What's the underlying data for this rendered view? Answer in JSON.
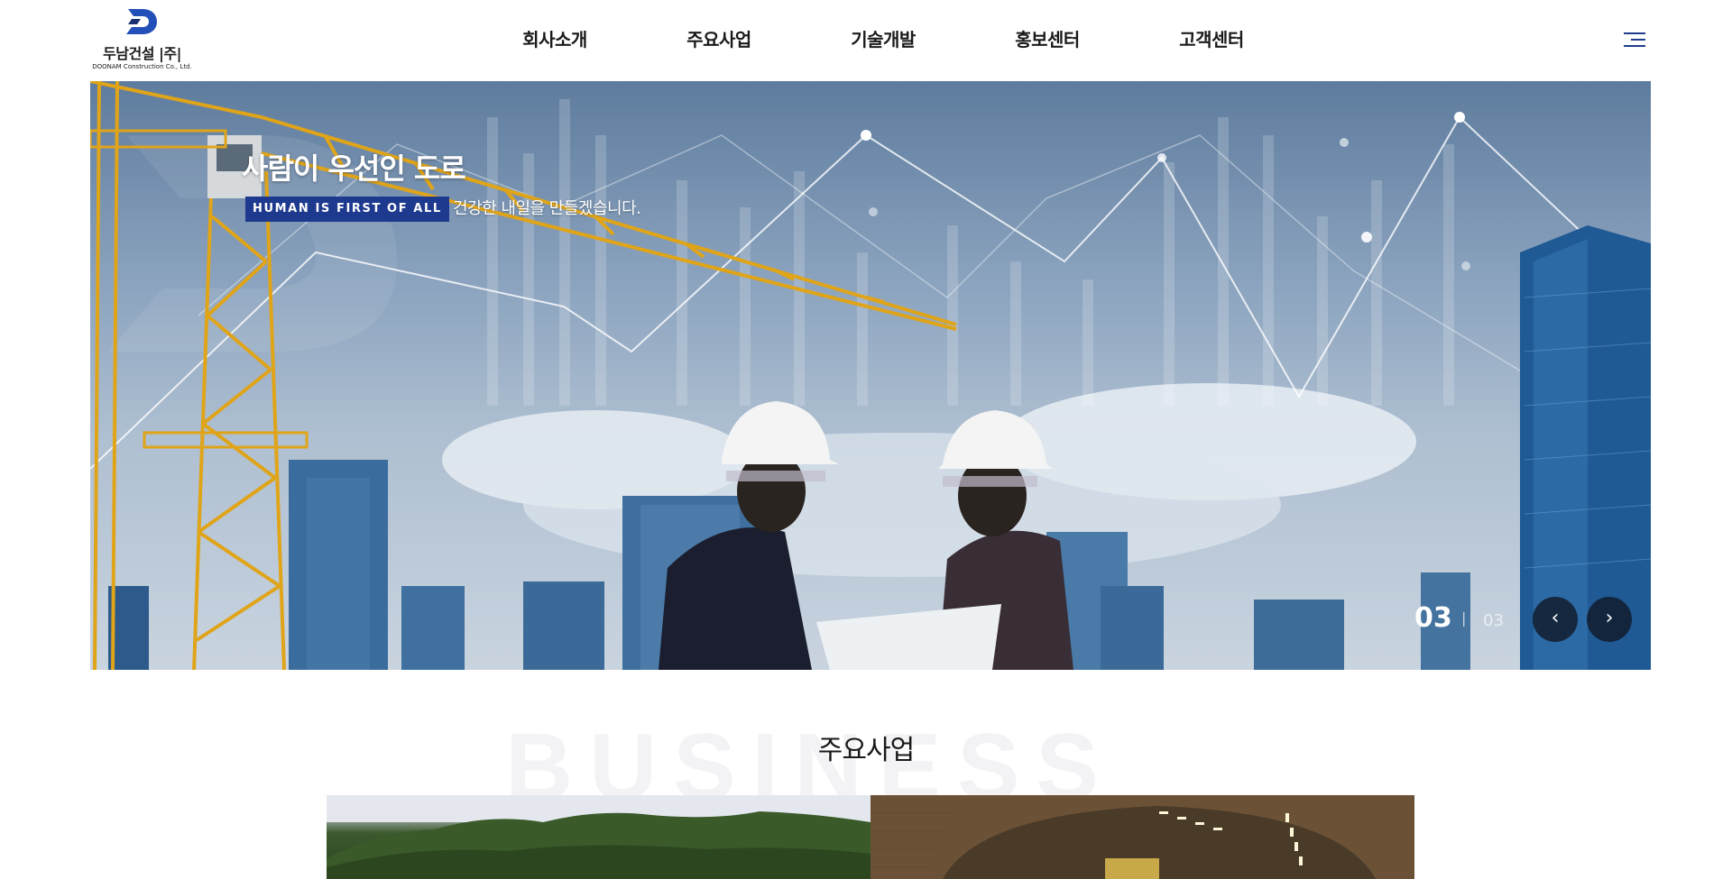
{
  "logo": {
    "name": "두남건설 |주|",
    "sub": "DOONAM Construction Co., Ltd.",
    "mark_icon": "d-letter-logo-icon"
  },
  "nav": {
    "items": [
      "회사소개",
      "주요사업",
      "기술개발",
      "홍보센터",
      "고객센터"
    ],
    "menu_icon": "hamburger-menu-icon"
  },
  "hero": {
    "title": "사람이 우선인 도로",
    "badge": "HUMAN IS FIRST OF ALL",
    "subtitle": "건강한 내일을 만들겠습니다.",
    "counter_current": "03",
    "counter_separator": "|",
    "counter_total": "03",
    "prev_icon": "chevron-left-icon",
    "next_icon": "chevron-right-icon",
    "prev_glyph": "‹",
    "next_glyph": "›"
  },
  "business": {
    "background_word": "BUSINESS",
    "title": "주요사업"
  },
  "colors": {
    "brand_navy": "#1e3a8f",
    "logo_blue": "#2350b8",
    "text_dark": "#1a1a1a"
  }
}
